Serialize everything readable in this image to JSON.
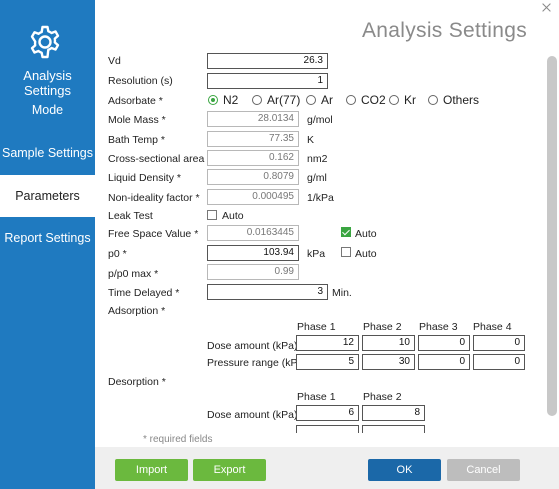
{
  "sidebar": {
    "title": "Analysis Settings",
    "items": [
      {
        "label": "Mode"
      },
      {
        "label": "Sample Settings"
      },
      {
        "label": "Parameters"
      },
      {
        "label": "Report Settings"
      }
    ],
    "active_item": "Parameters",
    "background_color": "#1f7ac0"
  },
  "header": {
    "title": "Analysis Settings"
  },
  "form": {
    "vd": {
      "label": "Vd",
      "value": "26.3"
    },
    "resolution": {
      "label": "Resolution (s)",
      "value": "1"
    },
    "adsorbate": {
      "label": "Adsorbate *",
      "options": [
        "N2",
        "Ar(77)",
        "Ar",
        "CO2",
        "Kr",
        "Others"
      ],
      "selected": "N2"
    },
    "mole_mass": {
      "label": "Mole Mass *",
      "value": "28.0134",
      "unit": "g/mol"
    },
    "bath_temp": {
      "label": "Bath Temp *",
      "value": "77.35",
      "unit": "K"
    },
    "cross_area": {
      "label": "Cross-sectional area *",
      "value": "0.162",
      "unit": "nm2"
    },
    "liquid_density": {
      "label": "Liquid Density *",
      "value": "0.8079",
      "unit": "g/ml"
    },
    "non_ideality": {
      "label": "Non-ideality factor *",
      "value": "0.000495",
      "unit": "1/kPa"
    },
    "leak_test": {
      "label": "Leak Test",
      "auto_label": "Auto",
      "auto_checked": false
    },
    "free_space": {
      "label": "Free Space Value *",
      "value": "0.0163445",
      "auto_label": "Auto",
      "auto_checked": true
    },
    "p0": {
      "label": "p0 *",
      "value": "103.94",
      "unit": "kPa",
      "auto_label": "Auto",
      "auto_checked": false
    },
    "pp0_max": {
      "label": "p/p0 max *",
      "value": "0.99"
    },
    "time_delayed": {
      "label": "Time Delayed *",
      "value": "3",
      "unit": "Min."
    },
    "adsorption": {
      "label": "Adsorption *",
      "phases": [
        "Phase 1",
        "Phase 2",
        "Phase 3",
        "Phase 4"
      ],
      "dose_label": "Dose amount (kPa)",
      "dose_values": [
        "12",
        "10",
        "0",
        "0"
      ],
      "pressure_label": "Pressure range (kPa)",
      "pressure_values": [
        "5",
        "30",
        "0",
        "0"
      ]
    },
    "desorption": {
      "label": "Desorption *",
      "phases": [
        "Phase 1",
        "Phase 2"
      ],
      "dose_label": "Dose amount (kPa)",
      "dose_values": [
        "6",
        "8"
      ]
    },
    "required_note": "* required fields"
  },
  "footer": {
    "import_label": "Import",
    "export_label": "Export",
    "ok_label": "OK",
    "cancel_label": "Cancel"
  },
  "colors": {
    "accent_green": "#6bb93e",
    "primary_blue": "#1b68a8",
    "disabled_gray": "#bdbdbd",
    "radio_green": "#3aa541"
  }
}
